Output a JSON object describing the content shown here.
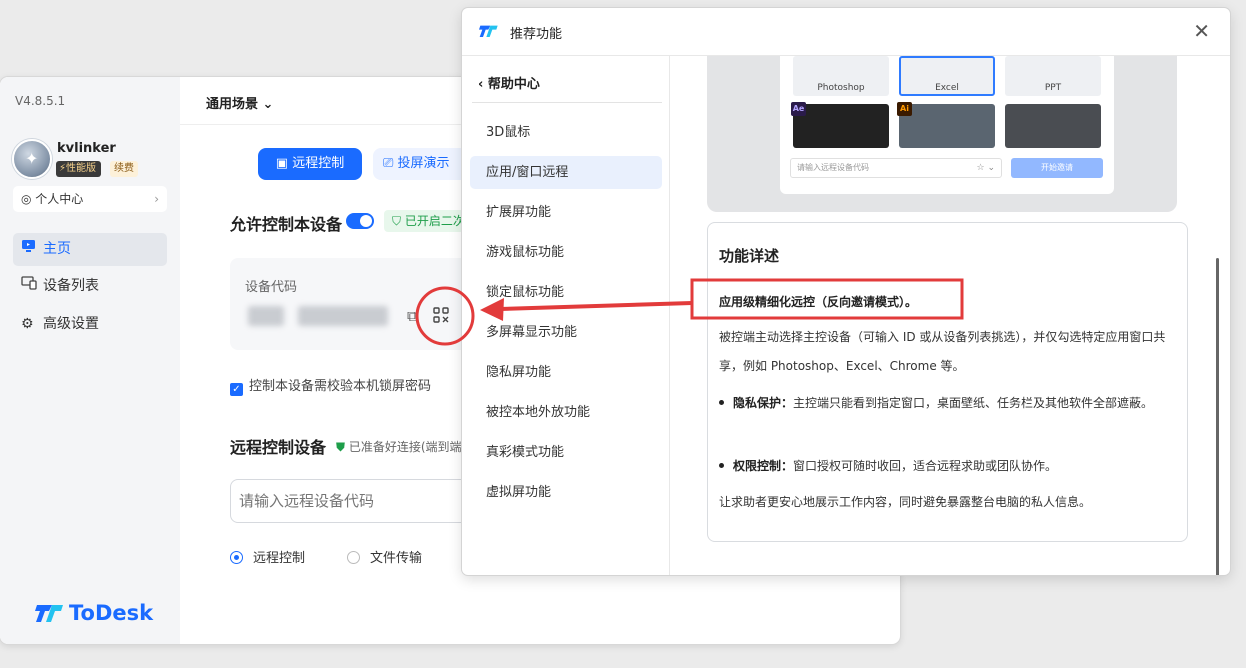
{
  "main": {
    "version": "V4.8.5.1",
    "user": {
      "name": "kvlinker",
      "badge_perf": "⚡性能版",
      "badge_renew": "续费"
    },
    "personal_center": "个人中心",
    "nav": [
      {
        "label": "主页",
        "icon": "home-icon"
      },
      {
        "label": "设备列表",
        "icon": "devices-icon"
      },
      {
        "label": "高级设置",
        "icon": "gear-icon"
      }
    ],
    "brand": "ToDesk",
    "scene_label": "通用场景",
    "tabs": {
      "remote": "远程控制",
      "cast": "投屏演示"
    },
    "allow_title": "允许控制本设备",
    "allow_status": "已开启二次验证",
    "device_code_label": "设备代码",
    "lock_check_label": "控制本设备需校验本机锁屏密码",
    "remote_title": "远程控制设备",
    "remote_status": "已准备好连接(端到端加密)",
    "remote_input_placeholder": "请输入远程设备代码",
    "radio_options": [
      "远程控制",
      "文件传输"
    ]
  },
  "dialog": {
    "title": "推荐功能",
    "back_label": "帮助中心",
    "items": [
      "3D鼠标",
      "应用/窗口远程",
      "扩展屏功能",
      "游戏鼠标功能",
      "锁定鼠标功能",
      "多屏幕显示功能",
      "隐私屏功能",
      "被控本地外放功能",
      "真彩模式功能",
      "虚拟屏功能"
    ],
    "active_index": 1,
    "preview": {
      "tiles": [
        "Photoshop",
        "Excel",
        "PPT"
      ],
      "apps": [
        "Ae",
        "Ai"
      ],
      "input_placeholder": "请输入远程设备代码",
      "button": "开始邀请"
    },
    "detail": {
      "title": "功能详述",
      "subtitle": "应用级精细化远控（反向邀请模式）。",
      "paragraph": "被控端主动选择主控设备（可输入 ID 或从设备列表挑选），并仅勾选特定应用窗口共享，例如 Photoshop、Excel、Chrome 等。",
      "bullets": [
        {
          "label": "隐私保护：",
          "text": "主控端只能看到指定窗口，桌面壁纸、任务栏及其他软件全部遮蔽。"
        },
        {
          "label": "权限控制：",
          "text": "窗口授权可随时收回，适合远程求助或团队协作。"
        }
      ],
      "closing": "让求助者更安心地展示工作内容，同时避免暴露整台电脑的私人信息。"
    }
  },
  "colors": {
    "accent": "#1a6bff",
    "annotation": "#e23b3b",
    "success": "#1e9e4a"
  }
}
